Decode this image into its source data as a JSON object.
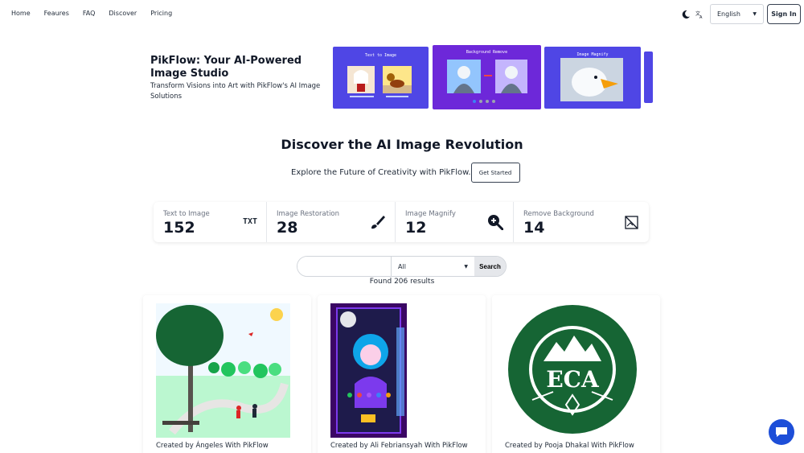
{
  "nav": {
    "links": [
      "Home",
      "Feaures",
      "FAQ",
      "Discover",
      "Pricing"
    ],
    "language": "English",
    "sign_in": "Sign In",
    "icons": [
      "moon-icon",
      "translate-icon",
      "caret-down-icon"
    ]
  },
  "hero": {
    "title": "PikFlow: Your AI-Powered Image Studio",
    "subtitle": "Transform Visions into Art with PikFlow's AI Image Solutions",
    "carousel": [
      {
        "label": "Text to Image"
      },
      {
        "label": "Background Remove"
      },
      {
        "label": "Image Magnify"
      }
    ],
    "active_slide": 1
  },
  "discover": {
    "title": "Discover the AI Image Revolution",
    "subtitle": "Explore the Future of Creativity with PikFlow.",
    "cta": "Get Started"
  },
  "stats": [
    {
      "label": "Text to Image",
      "value": "152",
      "icon": "txt-icon",
      "icon_text": "TXT"
    },
    {
      "label": "Image Restoration",
      "value": "28",
      "icon": "brush-icon"
    },
    {
      "label": "Image Magnify",
      "value": "12",
      "icon": "zoom-in-icon"
    },
    {
      "label": "Remove Background",
      "value": "14",
      "icon": "image-off-icon"
    }
  ],
  "search": {
    "query": "",
    "category": "All",
    "button": "Search",
    "results": "Found 206 results"
  },
  "cards": [
    {
      "caption": "Created by Ángeles With PikFlow"
    },
    {
      "caption": "Created by Ali Febriansyah With PikFlow"
    },
    {
      "caption": "Created by Pooja Dhakal With PikFlow"
    }
  ],
  "colors": {
    "accent": "#4f46e5",
    "slide_purple": "#6d28d9",
    "chat": "#1d4ed8"
  }
}
